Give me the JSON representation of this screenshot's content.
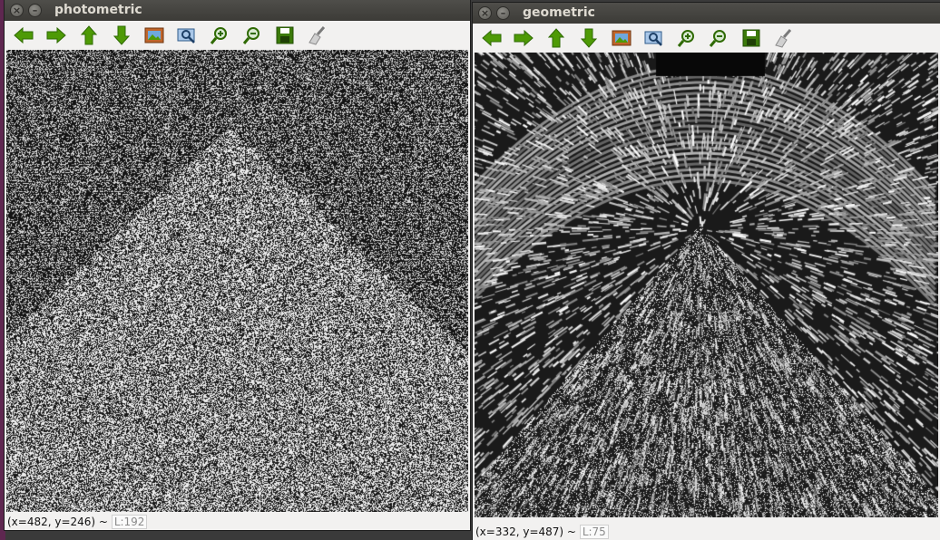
{
  "windows": {
    "photometric": {
      "title": "photometric",
      "status_coords": "(x=482, y=246) ~",
      "status_value": "L:192"
    },
    "geometric": {
      "title": "geometric",
      "status_coords": "(x=332, y=487) ~",
      "status_value": "L:75"
    }
  },
  "titlebar_buttons": {
    "close": "×",
    "minimize": "–"
  },
  "toolbar_icons": [
    "arrow-left-icon",
    "arrow-right-icon",
    "arrow-up-icon",
    "arrow-down-icon",
    "image-icon",
    "zoom-fit-icon",
    "zoom-in-icon",
    "zoom-out-icon",
    "save-icon",
    "clear-brush-icon"
  ],
  "colors": {
    "titlebar": "#3c3b37",
    "title_text": "#dfdbd2",
    "toolbar_green": "#4e9a06",
    "desktop_accent": "#5e2750"
  }
}
